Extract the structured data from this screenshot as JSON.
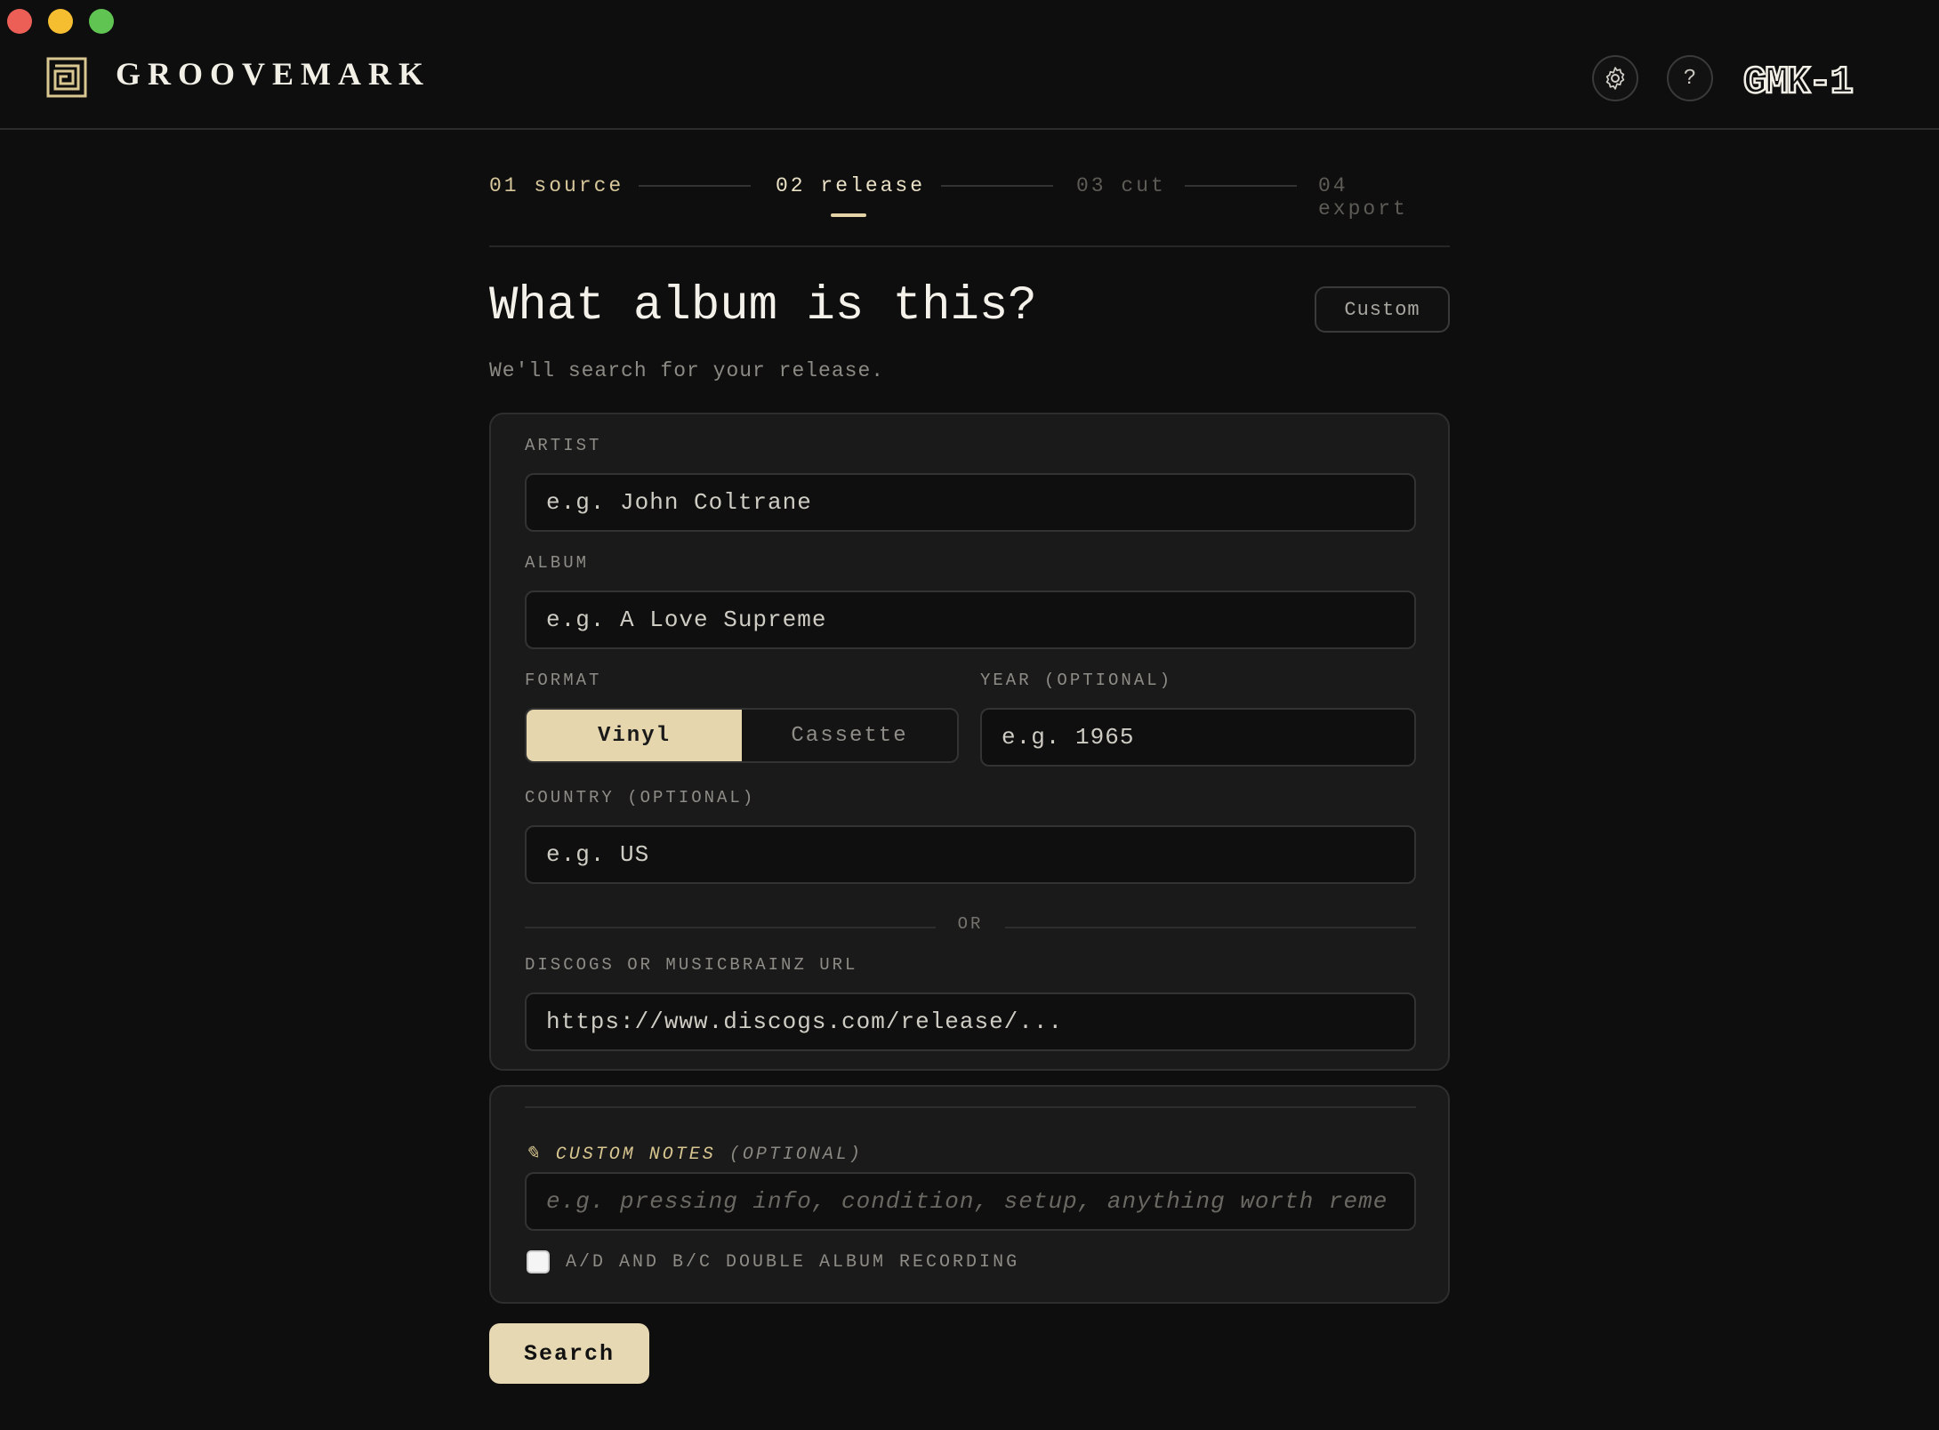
{
  "app": {
    "brand": "GROOVEMARK",
    "device_badge": "GMK-1",
    "help_glyph": "?",
    "icons": [
      "logo-icon",
      "gear-icon",
      "help-icon"
    ]
  },
  "stepper": {
    "steps": [
      {
        "label": "01 source",
        "state": "done"
      },
      {
        "label": "02 release",
        "state": "active"
      },
      {
        "label": "03 cut",
        "state": "upcoming"
      },
      {
        "label": "04 export",
        "state": "upcoming"
      }
    ]
  },
  "page": {
    "title": "What album is this?",
    "custom_button": "Custom",
    "subtitle": "We'll search for your release."
  },
  "form": {
    "artist": {
      "label": "ARTIST",
      "placeholder": "e.g. John Coltrane"
    },
    "album": {
      "label": "ALBUM",
      "placeholder": "e.g. A Love Supreme"
    },
    "format": {
      "label": "FORMAT",
      "options": [
        "Vinyl",
        "Cassette"
      ],
      "selected": "Vinyl"
    },
    "year": {
      "label": "YEAR (OPTIONAL)",
      "placeholder": "e.g. 1965"
    },
    "country": {
      "label": "COUNTRY (OPTIONAL)",
      "placeholder": "e.g. US"
    },
    "or_divider": "OR",
    "url": {
      "label": "DISCOGS OR MUSICBRAINZ URL",
      "placeholder": "https://www.discogs.com/release/..."
    }
  },
  "notes": {
    "icon": "pencil-icon",
    "label": "CUSTOM NOTES",
    "label_optional": "(OPTIONAL)",
    "placeholder": "e.g. pressing info, condition, setup, anything worth reme",
    "double_album_label": "A/D AND B/C DOUBLE ALBUM RECORDING",
    "double_album_checked": false
  },
  "actions": {
    "search": "Search"
  },
  "colors": {
    "accent": "#e5d6ad",
    "background": "#0e0e0e",
    "card": "#1a1a1a"
  }
}
